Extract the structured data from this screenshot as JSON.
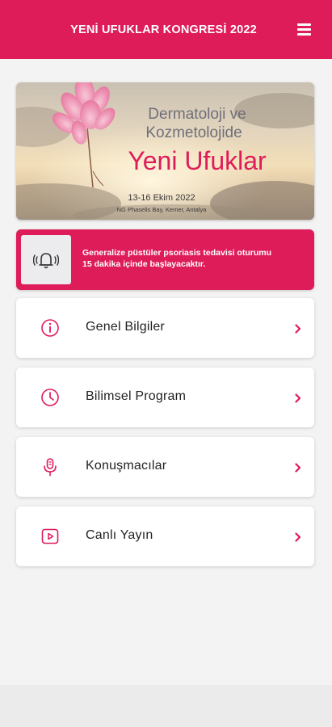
{
  "header": {
    "title": "YENİ UFUKLAR KONGRESİ 2022",
    "menu_icon": "hamburger-icon"
  },
  "banner": {
    "line1": "Dermatoloji ve",
    "line2": "Kozmetolojide",
    "headline": "Yeni Ufuklar",
    "dates": "13-16 Ekim 2022",
    "venue": "NG Phaselis Bay, Kemer, Antalya",
    "accent_color": "#de1c5a"
  },
  "notification": {
    "icon": "bell-ringing-icon",
    "line1": "Generalize püstüler psoriasis tedavisi oturumu",
    "line2": "15 dakika içinde başlayacaktır."
  },
  "menu": [
    {
      "label": "Genel Bilgiler",
      "icon": "info-icon"
    },
    {
      "label": "Bilimsel Program",
      "icon": "clock-icon"
    },
    {
      "label": "Konuşmacılar",
      "icon": "microphone-icon"
    },
    {
      "label": "Canlı Yayın",
      "icon": "play-icon"
    }
  ],
  "colors": {
    "brand": "#de1c5a",
    "background": "#f3f3f3",
    "card": "#ffffff"
  }
}
